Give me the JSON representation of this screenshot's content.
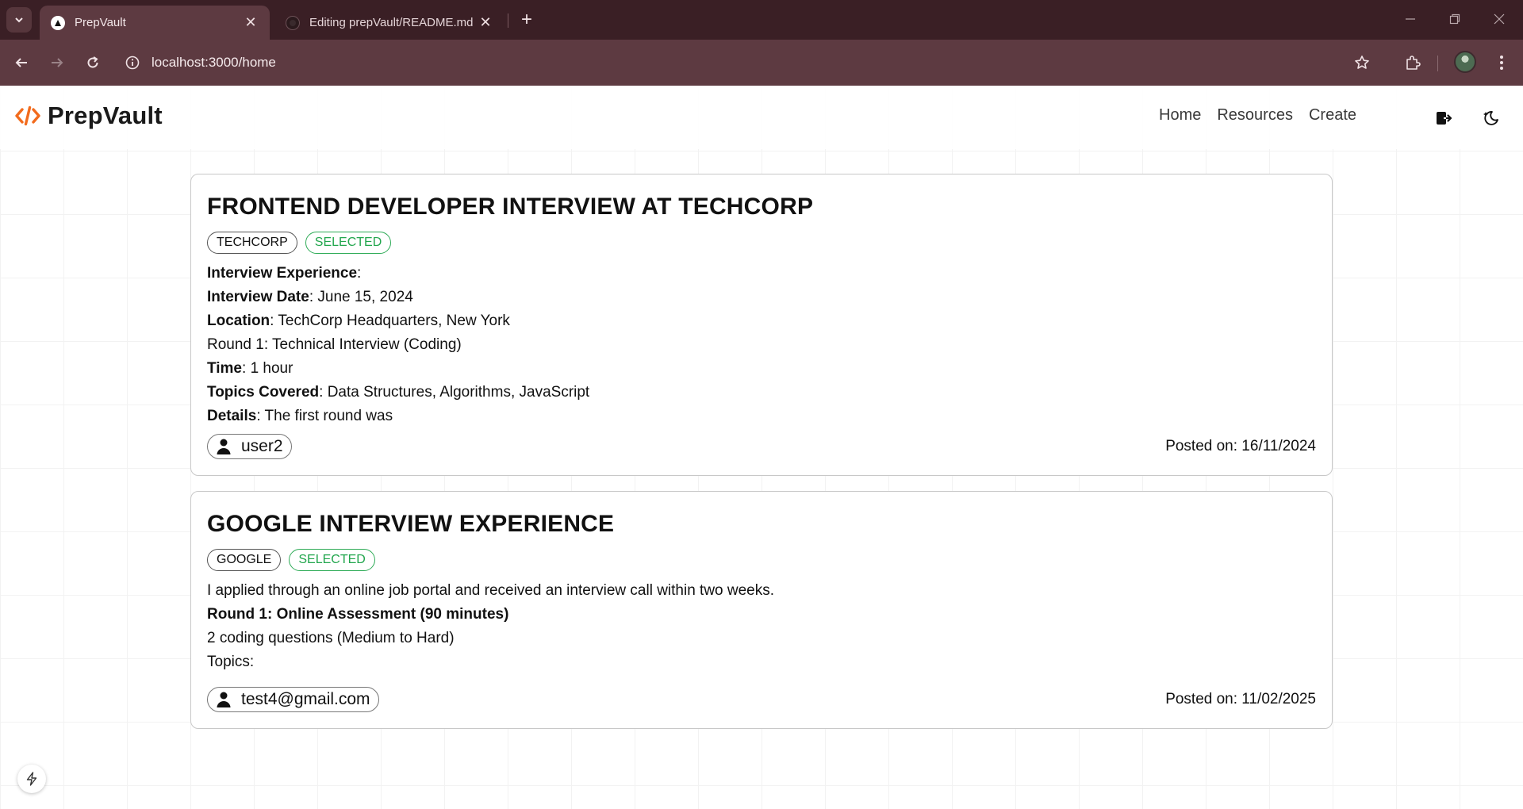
{
  "browser": {
    "tabs": [
      {
        "title": "PrepVault",
        "active": true
      },
      {
        "title": "Editing prepVault/README.md",
        "active": false
      }
    ],
    "new_tab_symbol": "+",
    "url": "localhost:3000/home"
  },
  "navbar": {
    "brand": "PrepVault",
    "links": [
      "Home",
      "Resources",
      "Create"
    ]
  },
  "posts": [
    {
      "title": "FRONTEND DEVELOPER INTERVIEW AT TECHCORP",
      "tags": [
        "TECHCORP",
        "SELECTED"
      ],
      "lines": [
        {
          "label": "Interview Experience",
          "value": ":"
        },
        {
          "label": "Interview Date",
          "value": ": June 15, 2024"
        },
        {
          "label": "Location",
          "value": ": TechCorp Headquarters, New York"
        },
        {
          "label": "",
          "value": "Round 1: Technical Interview (Coding)"
        },
        {
          "label": "Time",
          "value": ": 1 hour"
        },
        {
          "label": "Topics Covered",
          "value": ": Data Structures, Algorithms, JavaScript"
        },
        {
          "label": "Details",
          "value": ": The first round was"
        }
      ],
      "author": "user2",
      "posted": "Posted on: 16/11/2024"
    },
    {
      "title": "GOOGLE INTERVIEW EXPERIENCE",
      "tags": [
        "GOOGLE",
        "SELECTED"
      ],
      "lines": [
        {
          "label": "",
          "value": "I applied through an online job portal and received an interview call within two weeks."
        },
        {
          "label": "Round 1: Online Assessment (90 minutes)",
          "value": ""
        },
        {
          "label": "",
          "value": "2 coding questions (Medium to Hard)"
        },
        {
          "label": "",
          "value": "Topics:"
        }
      ],
      "author": "test4@gmail.com",
      "posted": "Posted on: 11/02/2025"
    }
  ],
  "colors": {
    "tabbar": "#3a1f25",
    "toolbar": "#5d3a41",
    "brand_accent": "#f26b1d",
    "selected_green": "#22a64d"
  },
  "icons": {
    "brand": "code-brackets-icon",
    "logout": "logout-icon",
    "theme": "moon-icon",
    "fab": "lightning-icon"
  }
}
